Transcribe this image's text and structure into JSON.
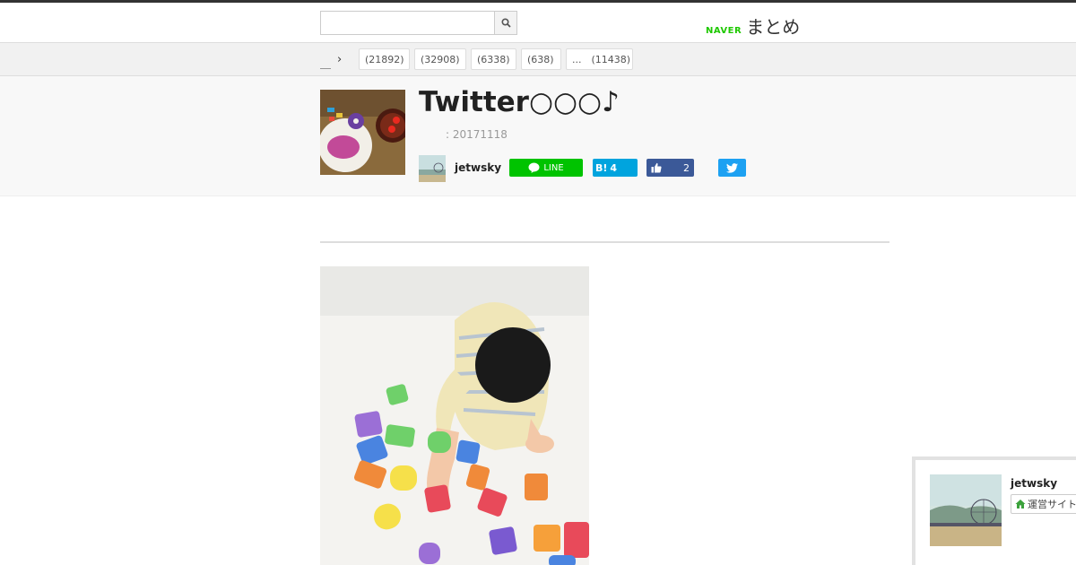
{
  "header": {
    "search": {
      "value": "",
      "placeholder": ""
    },
    "logo": {
      "brand": "NAVER",
      "service": "まとめ"
    }
  },
  "breadcrumb": {
    "home_label": "＿",
    "separator": "›",
    "categories": [
      {
        "label": "(21892)"
      },
      {
        "label": "(32908)"
      },
      {
        "label": "(6338)"
      },
      {
        "label": "(638)"
      },
      {
        "label": "...　(11438)"
      }
    ]
  },
  "article": {
    "title": "Twitter○○○♪",
    "date": ": 20171118",
    "author": "jetwsky",
    "share": {
      "line_label": "LINE",
      "hatena_label": "B!",
      "hatena_count": "4",
      "like_count": "2"
    }
  },
  "sidebar_card": {
    "name": "jetwsky",
    "site_label": "運営サイト"
  },
  "icons": {
    "search": "search-icon",
    "line": "line-icon",
    "like": "thumbs-up-icon",
    "twitter": "twitter-bird-icon",
    "home": "house-icon"
  },
  "colors": {
    "line": "#00c300",
    "hatena": "#00a4de",
    "facebook": "#3b5998",
    "twitter": "#1da1f2",
    "naver": "#1ec800"
  }
}
